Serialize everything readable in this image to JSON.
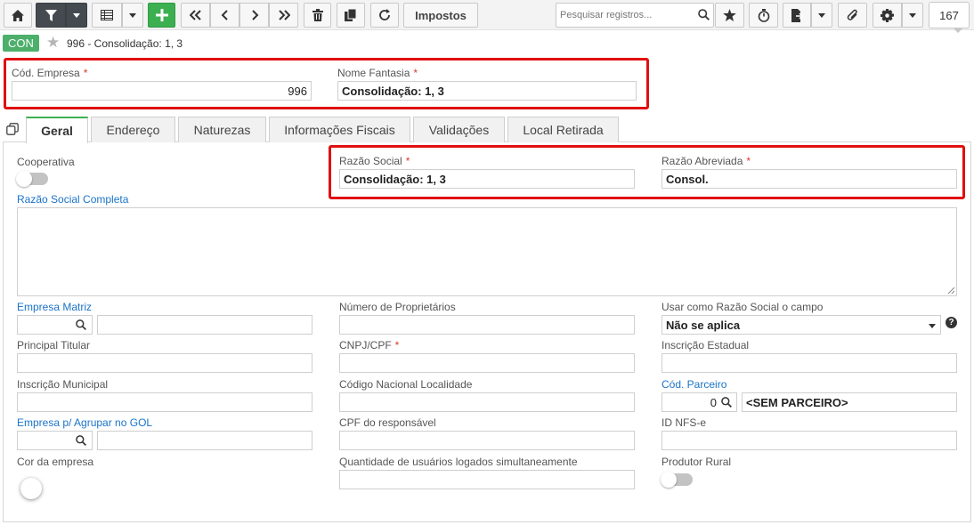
{
  "toolbar": {
    "impostos_label": "Impostos",
    "search_placeholder": "Pesquisar registros...",
    "record_count": "167"
  },
  "header": {
    "badge": "CON",
    "title": "996 - Consolidação: 1, 3"
  },
  "top_fields": {
    "cod_empresa_label": "Cód. Empresa",
    "cod_empresa_value": "996",
    "nome_fantasia_label": "Nome Fantasia",
    "nome_fantasia_value": "Consolidação: 1, 3",
    "required_mark": "*"
  },
  "tabs": [
    {
      "label": "Geral",
      "active": true
    },
    {
      "label": "Endereço"
    },
    {
      "label": "Naturezas"
    },
    {
      "label": "Informações Fiscais"
    },
    {
      "label": "Validações"
    },
    {
      "label": "Local Retirada"
    }
  ],
  "geral": {
    "cooperativa_label": "Cooperativa",
    "razao_social_label": "Razão Social",
    "razao_social_value": "Consolidação: 1, 3",
    "razao_abreviada_label": "Razão Abreviada",
    "razao_abreviada_value": "Consol.",
    "razao_completa_label": "Razão Social Completa",
    "empresa_matriz_label": "Empresa Matriz",
    "num_proprietarios_label": "Número de Proprietários",
    "usar_como_label": "Usar como Razão Social o campo",
    "usar_como_value": "Não se aplica",
    "principal_titular_label": "Principal Titular",
    "cnpj_label": "CNPJ/CPF",
    "inscricao_estadual_label": "Inscrição Estadual",
    "inscricao_municipal_label": "Inscrição Municipal",
    "codigo_nacional_label": "Código Nacional Localidade",
    "cod_parceiro_label": "Cód. Parceiro",
    "cod_parceiro_value": "0",
    "parceiro_nome": "<SEM PARCEIRO>",
    "empresa_gol_label": "Empresa p/ Agrupar no GOL",
    "cpf_responsavel_label": "CPF do responsável",
    "id_nfse_label": "ID NFS-e",
    "cor_empresa_label": "Cor da empresa",
    "qtd_usuarios_label": "Quantidade de usuários logados simultaneamente",
    "produtor_rural_label": "Produtor Rural"
  },
  "colors": {
    "accent_green": "#3cb050",
    "badge_green": "#4caf6a",
    "link_blue": "#1a73c8",
    "required_red": "#d93a2b",
    "highlight_red": "#e01010",
    "toolbar_dark": "#444a50"
  },
  "icons": [
    "home-icon",
    "filter-icon",
    "grid-icon",
    "plus-icon",
    "first-icon",
    "prev-icon",
    "next-icon",
    "last-icon",
    "trash-icon",
    "copy-icon",
    "refresh-icon",
    "search-icon",
    "star-icon",
    "stopwatch-icon",
    "export-icon",
    "paperclip-icon",
    "gear-icon",
    "clone-icon",
    "question-icon"
  ]
}
